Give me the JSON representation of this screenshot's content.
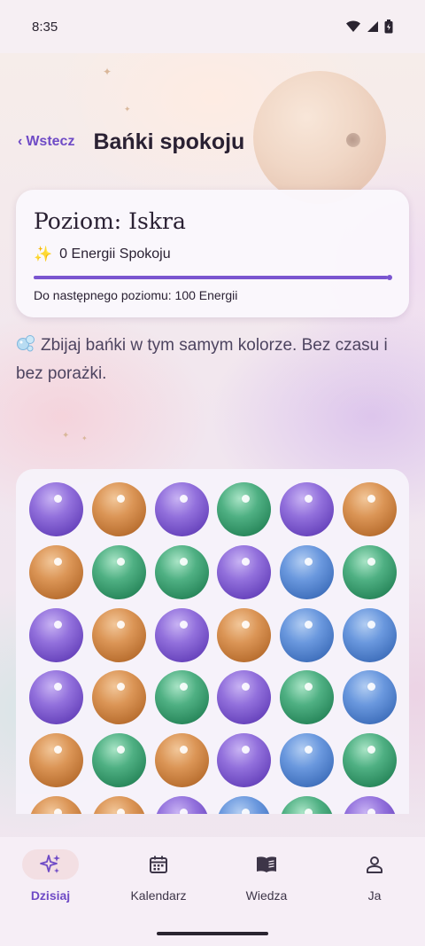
{
  "status_bar": {
    "time": "8:35",
    "icons": [
      "wifi-icon",
      "signal-icon",
      "battery-icon"
    ]
  },
  "header": {
    "back_label": "Wstecz",
    "back_arrow": "‹",
    "title": "Bańki spokoju"
  },
  "level_card": {
    "level_label": "Poziom: Iskra",
    "energy_icon": "✨",
    "energy_text": "0 Energii Spokoju",
    "progress_fraction": 0.99,
    "next_level_text": "Do następnego poziomu: 100 Energii"
  },
  "hint": {
    "icon": "bubbles-icon",
    "text": "Zbijaj bańki w tym samym kolorze. Bez czasu i bez porażki."
  },
  "board": {
    "colors": {
      "purple": "#7b57cc",
      "orange": "#cc8040",
      "green": "#3a9d6e",
      "blue": "#5585d0"
    },
    "rows": [
      [
        "purple",
        "orange",
        "purple",
        "green",
        "purple",
        "orange"
      ],
      [
        "orange",
        "green",
        "green",
        "purple",
        "blue",
        "green"
      ],
      [
        "purple",
        "orange",
        "purple",
        "orange",
        "blue",
        "blue"
      ],
      [
        "purple",
        "orange",
        "green",
        "purple",
        "green",
        "blue"
      ],
      [
        "orange",
        "green",
        "orange",
        "purple",
        "blue",
        "green"
      ],
      [
        "orange",
        "orange",
        "purple",
        "blue",
        "green",
        "purple"
      ]
    ]
  },
  "bottom_nav": {
    "items": [
      {
        "label": "Dzisiaj",
        "icon": "sparkles-icon",
        "active": true
      },
      {
        "label": "Kalendarz",
        "icon": "calendar-icon",
        "active": false
      },
      {
        "label": "Wiedza",
        "icon": "book-icon",
        "active": false
      },
      {
        "label": "Ja",
        "icon": "person-icon",
        "active": false
      }
    ]
  },
  "theme": {
    "accent": "#6f4bc6",
    "active_pill": "#f3dfe3"
  }
}
